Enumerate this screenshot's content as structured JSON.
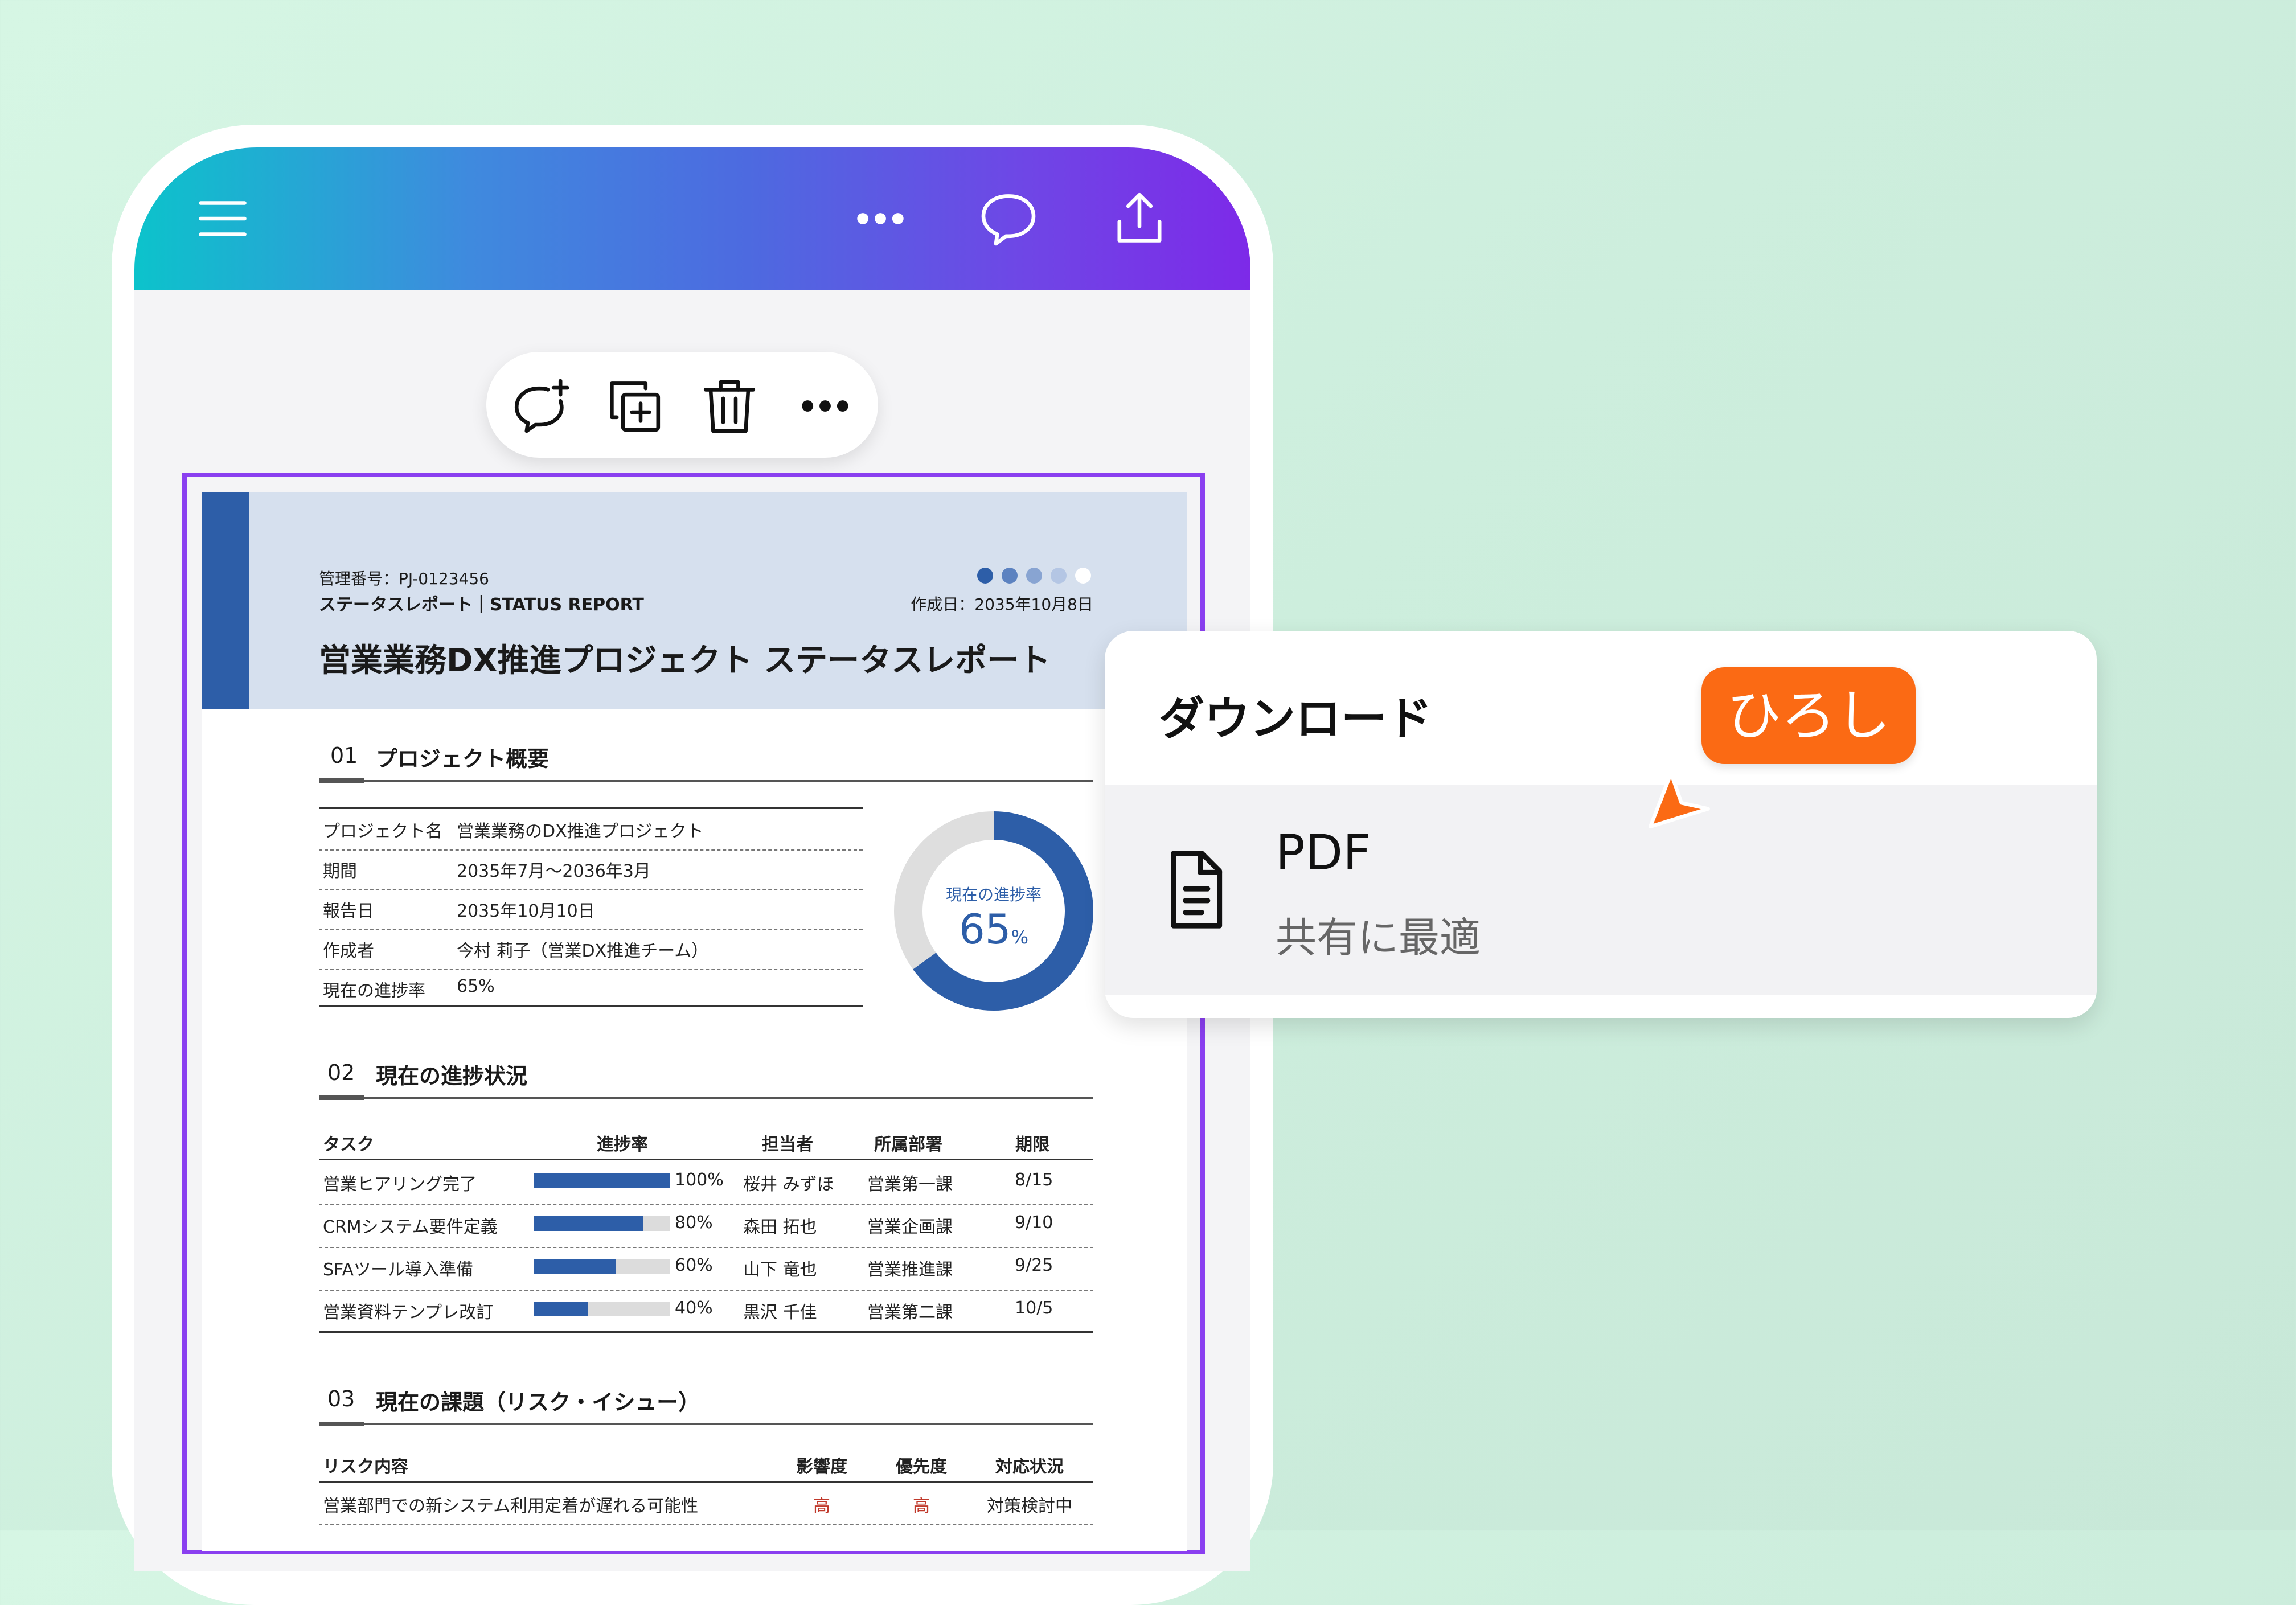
{
  "colors": {
    "header_gradient": [
      "#0cc3cb",
      "#4d6ae0",
      "#7d2ae8"
    ],
    "selection": "#8a3ff0",
    "doc_accent": "#2d5ea8",
    "badge": "#fb6a14",
    "risk_high": "#c0392b"
  },
  "header": {
    "icons": [
      "menu-icon",
      "more-icon",
      "comment-icon",
      "share-icon"
    ]
  },
  "context_toolbar": {
    "icons": [
      "add-comment-icon",
      "duplicate-icon",
      "trash-icon",
      "more-icon"
    ]
  },
  "document": {
    "mgmt_no": "管理番号：PJ-0123456",
    "report_label": "ステータスレポート｜STATUS REPORT",
    "created_date": "作成日：2035年10月8日",
    "title": "営業業務DX推進プロジェクト ステータスレポート",
    "section1": {
      "num": "01",
      "title": "プロジェクト概要",
      "rows": [
        {
          "label": "プロジェクト名",
          "value": "営業業務のDX推進プロジェクト"
        },
        {
          "label": "期間",
          "value": "2035年7月～2036年3月"
        },
        {
          "label": "報告日",
          "value": "2035年10月10日"
        },
        {
          "label": "作成者",
          "value": "今村 莉子（営業DX推進チーム）"
        },
        {
          "label": "現在の進捗率",
          "value": "65%"
        }
      ],
      "donut": {
        "label": "現在の進捗率",
        "value": "65",
        "unit": "%",
        "progress": 0.65
      }
    },
    "section2": {
      "num": "02",
      "title": "現在の進捗状況",
      "headers": [
        "タスク",
        "進捗率",
        "担当者",
        "所属部署",
        "期限"
      ],
      "rows": [
        {
          "task": "営業ヒアリング完了",
          "progress": 1.0,
          "pct": "100%",
          "owner": "桜井 みずほ",
          "dept": "営業第一課",
          "due": "8/15"
        },
        {
          "task": "CRMシステム要件定義",
          "progress": 0.8,
          "pct": "80%",
          "owner": "森田 拓也",
          "dept": "営業企画課",
          "due": "9/10"
        },
        {
          "task": "SFAツール導入準備",
          "progress": 0.6,
          "pct": "60%",
          "owner": "山下 竜也",
          "dept": "営業推進課",
          "due": "9/25"
        },
        {
          "task": "営業資料テンプレ改訂",
          "progress": 0.4,
          "pct": "40%",
          "owner": "黒沢 千佳",
          "dept": "営業第二課",
          "due": "10/5"
        }
      ]
    },
    "section3": {
      "num": "03",
      "title": "現在の課題（リスク・イシュー）",
      "headers": [
        "リスク内容",
        "影響度",
        "優先度",
        "対応状況"
      ],
      "rows": [
        {
          "risk": "営業部門での新システム利用定着が遅れる可能性",
          "impact": "高",
          "priority": "高",
          "status": "対策検討中"
        }
      ]
    }
  },
  "download": {
    "title": "ダウンロード",
    "option": {
      "icon": "document-icon",
      "name": "PDF",
      "desc": "共有に最適"
    }
  },
  "cursor": {
    "label": "ひろし"
  }
}
